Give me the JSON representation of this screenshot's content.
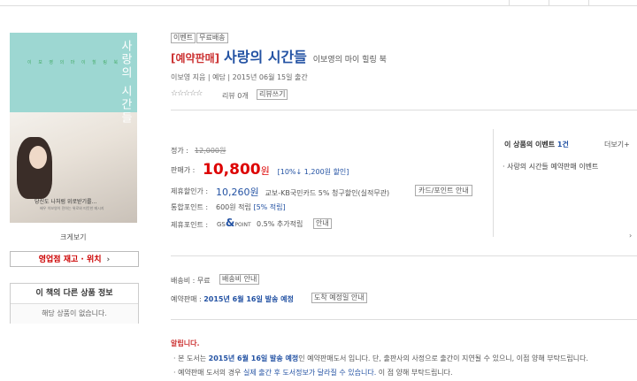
{
  "cover": {
    "title": "사랑의 시간들",
    "subtitle": "이 보 영 의 마 이 힐 링 북",
    "quote": "당신도 나처럼 위로받기를…",
    "quote_sub": "배우 이보영이 전하는 위로와 따뜻한 메시지"
  },
  "zoom_label": "크게보기",
  "stock_button": "영업점 재고 · 위치",
  "stock_arrow": "›",
  "other_info": {
    "title": "이 책의 다른 상품 정보",
    "body": "해당 상품이 없습니다."
  },
  "badges": [
    "이벤트",
    "무료배송"
  ],
  "product": {
    "pre_tag": "[예약판매]",
    "title": "사랑의 시간들",
    "subtitle": "이보영의 마이 힐링 북",
    "meta": "이보영 지음 | 예담 | 2015년 06월 15일 출간"
  },
  "rating": {
    "stars": "☆☆☆☆☆",
    "review_count": "리뷰 0개",
    "review_button": "리뷰쓰기"
  },
  "price": {
    "list_label": "정가 :",
    "list_value": "12,000원",
    "sale_label": "판매가 :",
    "sale_value": "10,800",
    "sale_unit": "원",
    "sale_detail": "[10%↓ 1,200원 할인]",
    "partner_label": "제휴할인가 :",
    "partner_value": "10,260원",
    "partner_text": "교보-KB국민카드 5% 청구할인(실적무관)",
    "card_button": "카드/포인트 안내",
    "points_label": "통합포인트 :",
    "points_text": "600원 적립",
    "points_pct": "[5% 적립]",
    "gs_label": "제휴포인트 :",
    "gs_logo_gs": "GS",
    "gs_logo_amp": "&",
    "gs_logo_point": "POINT",
    "gs_text": "0.5% 추가적립",
    "gs_button": "안내"
  },
  "event": {
    "title_prefix": "이 상품의 이벤트",
    "count": "1건",
    "more": "더보기+",
    "item": "· 사랑의 시간들 예약판매 이벤트"
  },
  "shipping": {
    "label": "배송비 : 무료",
    "button": "배송비 안내",
    "pre_label": "예약판매 :",
    "pre_date": "2015년 6월 16일 발송 예정",
    "arrival_button": "도착 예정일 안내"
  },
  "notice": {
    "title": "알립니다.",
    "line1_a": "· 본 도서는",
    "line1_b": "2015년 6월 16일 발송 예정",
    "line1_c": "인 예약판매도서 입니다. 단, 출판사의 사정으로 출간이 지연될 수 있으니, 이점 양해 부탁드립니다.",
    "line2_a": "· 예약판매 도서의 경우",
    "line2_b": "실제 출간 후 도서정보가 달라질 수 있습니다.",
    "line2_c": "이 점 양해 부탁드립니다."
  },
  "scroll_arrow": "›"
}
